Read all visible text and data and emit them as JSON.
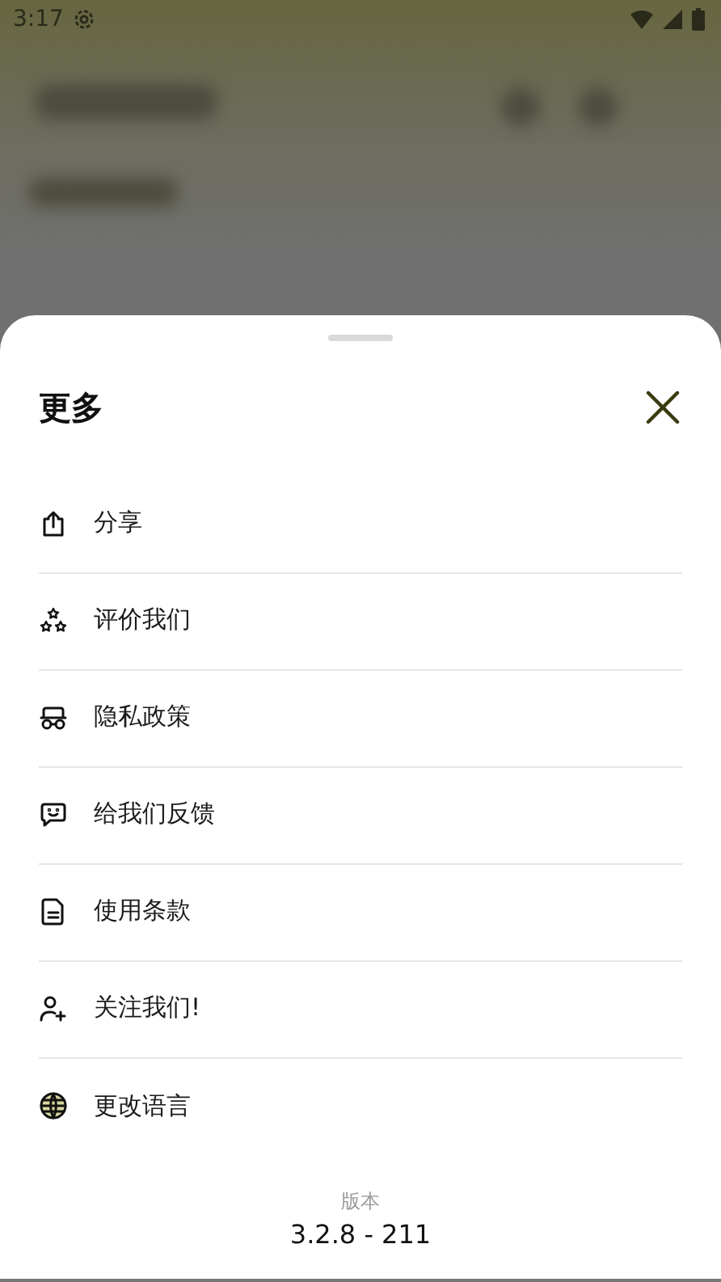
{
  "status_bar": {
    "time": "3:17"
  },
  "sheet": {
    "title": "更多",
    "items": [
      {
        "kind": "share",
        "label": "分享"
      },
      {
        "kind": "rate",
        "label": "评价我们"
      },
      {
        "kind": "privacy",
        "label": "隐私政策"
      },
      {
        "kind": "feedback",
        "label": "给我们反馈"
      },
      {
        "kind": "terms",
        "label": "使用条款"
      },
      {
        "kind": "follow",
        "label": "关注我们!"
      },
      {
        "kind": "language",
        "label": "更改语言"
      }
    ],
    "version_label": "版本",
    "version": "3.2.8 - 211"
  }
}
